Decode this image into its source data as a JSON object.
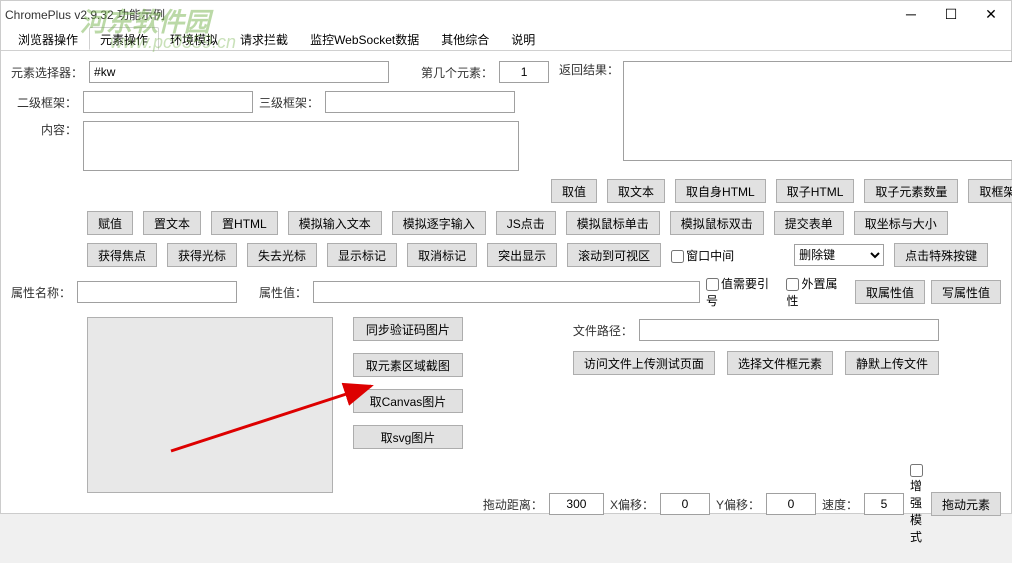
{
  "window": {
    "title": "ChromePlus v2.9.32 功能示例"
  },
  "watermark": {
    "line1": "河东软件园",
    "line2": "www.pc0359.cn"
  },
  "tabs": [
    "浏览器操作",
    "元素操作",
    "环境模拟",
    "请求拦截",
    "监控WebSocket数据",
    "其他综合",
    "说明"
  ],
  "labels": {
    "selector": "元素选择器：",
    "nth": "第几个元素：",
    "result": "返回结果：",
    "frame2": "二级框架：",
    "frame3": "三级框架：",
    "content": "内容：",
    "attrName": "属性名称：",
    "attrVal": "属性值：",
    "filePath": "文件路径：",
    "dragDist": "拖动距离：",
    "xOffset": "X偏移：",
    "yOffset": "Y偏移：",
    "speed": "速度：",
    "windowCenter": "窗口中间",
    "needQuote": "值需要引号",
    "externalAttr": "外置属性",
    "enhanceMode": "增强模式"
  },
  "values": {
    "selector": "#kw",
    "nth": "1",
    "dragDist": "300",
    "xOffset": "0",
    "yOffset": "0",
    "speed": "5",
    "deleteKey": "删除键"
  },
  "btnRow1": [
    "取值",
    "取文本",
    "取自身HTML",
    "取子HTML",
    "取子元素数量",
    "取框架源码"
  ],
  "btnRow2": [
    "赋值",
    "置文本",
    "置HTML",
    "模拟输入文本",
    "模拟逐字输入",
    "JS点击",
    "模拟鼠标单击",
    "模拟鼠标双击",
    "提交表单",
    "取坐标与大小"
  ],
  "btnRow3": [
    "获得焦点",
    "获得光标",
    "失去光标",
    "显示标记",
    "取消标记",
    "突出显示",
    "滚动到可视区"
  ],
  "btnSpecialKey": "点击特殊按键",
  "btnAttr": [
    "取属性值",
    "写属性值"
  ],
  "btnImgCol": [
    "同步验证码图片",
    "取元素区域截图",
    "取Canvas图片",
    "取svg图片"
  ],
  "btnFile": [
    "访问文件上传测试页面",
    "选择文件框元素",
    "静默上传文件"
  ],
  "btnDrag": "拖动元素"
}
